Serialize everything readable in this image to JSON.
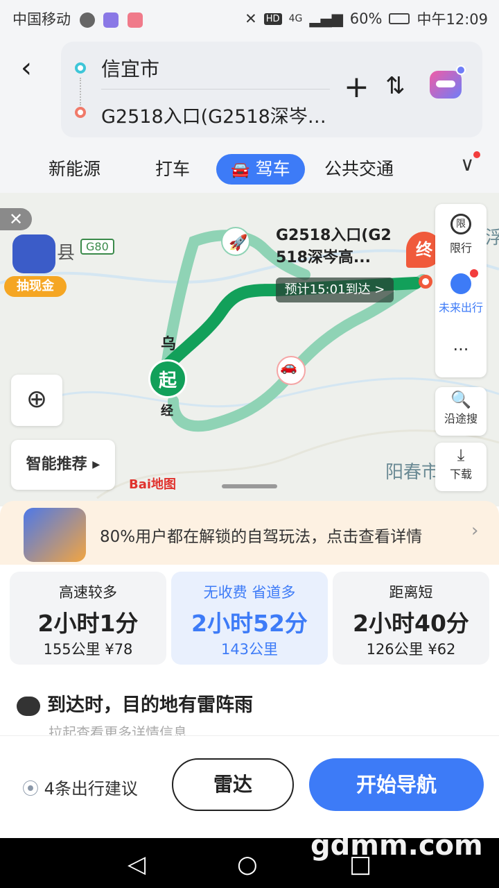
{
  "status_bar": {
    "carrier": "中国移动",
    "net": "HD",
    "signal": "4G",
    "battery": "60%",
    "time": "中午12:09"
  },
  "route": {
    "from": "信宜市",
    "to": "G2518入口(G2518深岑…"
  },
  "tabs": [
    {
      "label": "新能源"
    },
    {
      "label": "打车"
    },
    {
      "label": "驾车"
    },
    {
      "label": "公共交通"
    }
  ],
  "map": {
    "road_shield": "G80",
    "county_text": "县",
    "city_text": "阳春市",
    "right_edge_text": "浮",
    "start_label": "起",
    "end_label": "终",
    "dest_callout": "G2518入口(G2\n518深岑高...",
    "eta_callout": "预计15:01到达 >",
    "road_label_1": "乌",
    "road_label_2": "经",
    "cash_badge": "抽现金",
    "smart_label": "智能推荐 ▸",
    "baidu_logo": "Bai地图",
    "side": {
      "restrict": "限行",
      "restrict_icon_text": "限",
      "future": "未来出行",
      "more": "···",
      "along": "沿途搜",
      "download": "下载"
    }
  },
  "promo": {
    "text": "80%用户都在解锁的自驾玩法，点击查看详情",
    "arrow": "›"
  },
  "routes": [
    {
      "tag": "高速较多",
      "time": "2小时1分",
      "info": "155公里  ¥78"
    },
    {
      "tag": "无收费  省道多",
      "time": "2小时52分",
      "info": "143公里"
    },
    {
      "tag": "距离短",
      "time": "2小时40分",
      "info": "126公里  ¥62"
    }
  ],
  "weather": {
    "text": "到达时，目的地有雷阵雨",
    "tip": "拉起查看更多详情信息"
  },
  "actions": {
    "suggest": "4条出行建议",
    "radar": "雷达",
    "start": "开始导航"
  },
  "watermark": "gdmm.com",
  "colors": {
    "accent": "#3d7bf7",
    "route_main": "#12a05a",
    "route_alt": "#8fd3b5",
    "end_red": "#f05a3b"
  }
}
